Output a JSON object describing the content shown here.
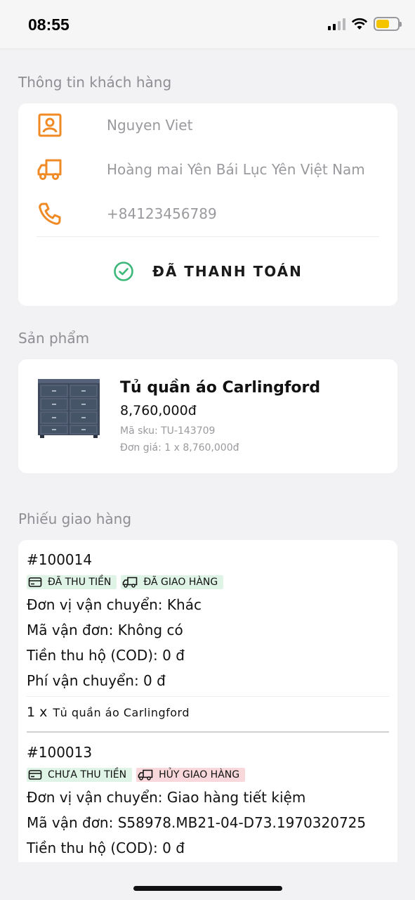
{
  "status_bar": {
    "time": "08:55"
  },
  "customer": {
    "section_title": "Thông tin khách hàng",
    "name": "Nguyen Viet",
    "address": "Hoàng mai Yên Bái Lục Yên Việt Nam",
    "phone": "+84123456789",
    "payment_status": "ĐÃ THANH TOÁN"
  },
  "products": {
    "section_title": "Sản phẩm",
    "items": [
      {
        "name": "Tủ quần áo Carlingford",
        "price": "8,760,000đ",
        "sku": "Mã sku: TU-143709",
        "unit_price": "Đơn giá: 1 x 8,760,000đ"
      }
    ]
  },
  "shipments": {
    "section_title": "Phiếu giao hàng",
    "items": [
      {
        "code": "#100014",
        "payment_badge": "ĐÃ THU TIỀN",
        "delivery_badge": "ĐÃ GIAO HÀNG",
        "carrier": "Đơn vị vận chuyển: Khác",
        "tracking": "Mã vận đơn: Không có",
        "cod": "Tiền thu hộ (COD): 0 đ",
        "fee": "Phí vận chuyển: 0 đ",
        "item_qty": "1 x",
        "item_name": "Tủ quần áo Carlingford"
      },
      {
        "code": "#100013",
        "payment_badge": "CHƯA THU TIỀN",
        "delivery_badge": "HỦY GIAO HÀNG",
        "carrier": "Đơn vị vận chuyển: Giao hàng tiết kiệm",
        "tracking": "Mã vận đơn: S58978.MB21-04-D73.1970320725",
        "cod": "Tiền thu hộ (COD): 0 đ"
      }
    ]
  },
  "colors": {
    "accent_orange": "#f08a24",
    "success_green": "#3cb878",
    "badge_green_bg": "#dff4e7",
    "badge_red_bg": "#f9d8dc"
  },
  "icons": [
    "contact-icon",
    "truck-icon",
    "phone-icon",
    "check-circle-icon",
    "card-icon",
    "delivery-truck-icon"
  ]
}
